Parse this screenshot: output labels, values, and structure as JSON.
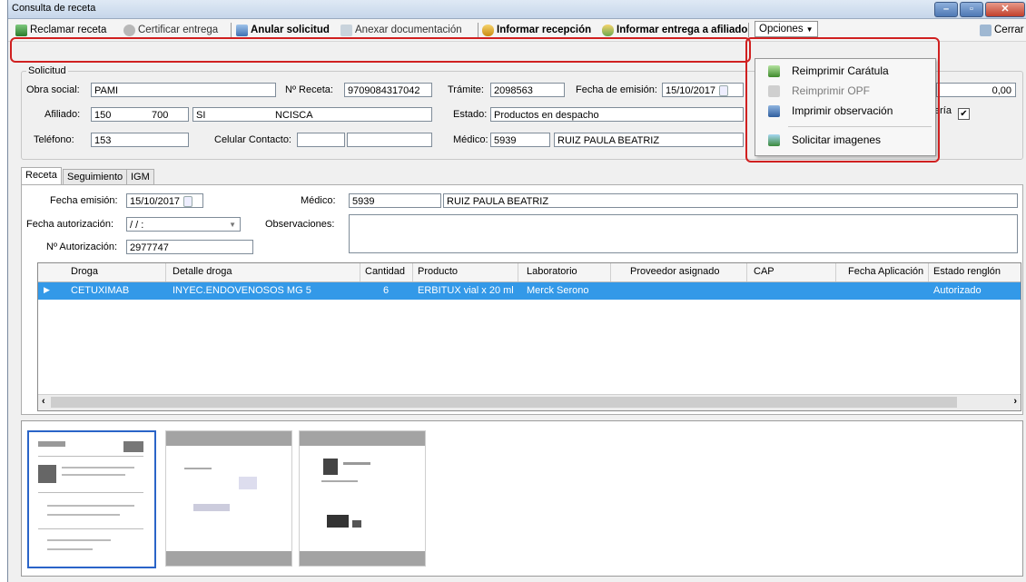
{
  "window": {
    "title": "Consulta de receta"
  },
  "toolbar": {
    "reclamar": "Reclamar receta",
    "certificar": "Certificar entrega",
    "anular": "Anular solicitud",
    "anexar": "Anexar documentación",
    "informar_recepcion": "Informar recepción",
    "informar_entrega": "Informar entrega a afiliado",
    "opciones": "Opciones",
    "cerrar": "Cerrar"
  },
  "menu": {
    "items": [
      "Reimprimir Carátula",
      "Reimprimir OPF",
      "Imprimir observación",
      "Solicitar imagenes"
    ]
  },
  "solicitud": {
    "group": "Solicitud",
    "obra_social_label": "Obra social:",
    "obra_social": "PAMI",
    "nro_receta_label": "Nº Receta:",
    "nro_receta": "9709084317042",
    "tramite_label": "Trámite:",
    "tramite": "2098563",
    "fecha_emision_label": "Fecha de emisión:",
    "fecha_emision": "15/10/2017",
    "monto": "0,00",
    "afiliado_label": "Afiliado:",
    "afiliado_nro": "150",
    "afiliado_nro2": "700",
    "afiliado_nombre1": "SI",
    "afiliado_nombre2": "NCISCA",
    "estado_label": "Estado:",
    "estado": "Productos en despacho",
    "eria_label": "ería",
    "telefono_label": "Teléfono:",
    "telefono": "153",
    "celular_label": "Celular Contacto:",
    "medico_label": "Médico:",
    "medico_cod": "5939",
    "medico_nombre": "RUIZ PAULA BEATRIZ"
  },
  "tabs": [
    "Receta",
    "Seguimiento",
    "IGM"
  ],
  "receta": {
    "fecha_emision_label": "Fecha emisión:",
    "fecha_emision": "15/10/2017",
    "medico_label": "Médico:",
    "medico_cod": "5939",
    "medico_nombre": "RUIZ PAULA BEATRIZ",
    "fecha_autorizacion_label": "Fecha autorización:",
    "fecha_autorizacion": "/ /   :",
    "observaciones_label": "Observaciones:",
    "nro_autorizacion_label": "Nº Autorización:",
    "nro_autorizacion": "2977747"
  },
  "grid": {
    "columns": [
      "Droga",
      "Detalle droga",
      "Cantidad",
      "Producto",
      "Laboratorio",
      "Proveedor asignado",
      "CAP",
      "Fecha Aplicación",
      "Estado renglón"
    ],
    "rows": [
      [
        "CETUXIMAB",
        "INYEC.ENDOVENOSOS MG 5",
        "6",
        "ERBITUX vial x 20 ml",
        "Merck Serono",
        "",
        "",
        "",
        "Autorizado"
      ]
    ]
  },
  "colors": {
    "selection": "#3399e8",
    "highlight_box": "#d02020"
  }
}
